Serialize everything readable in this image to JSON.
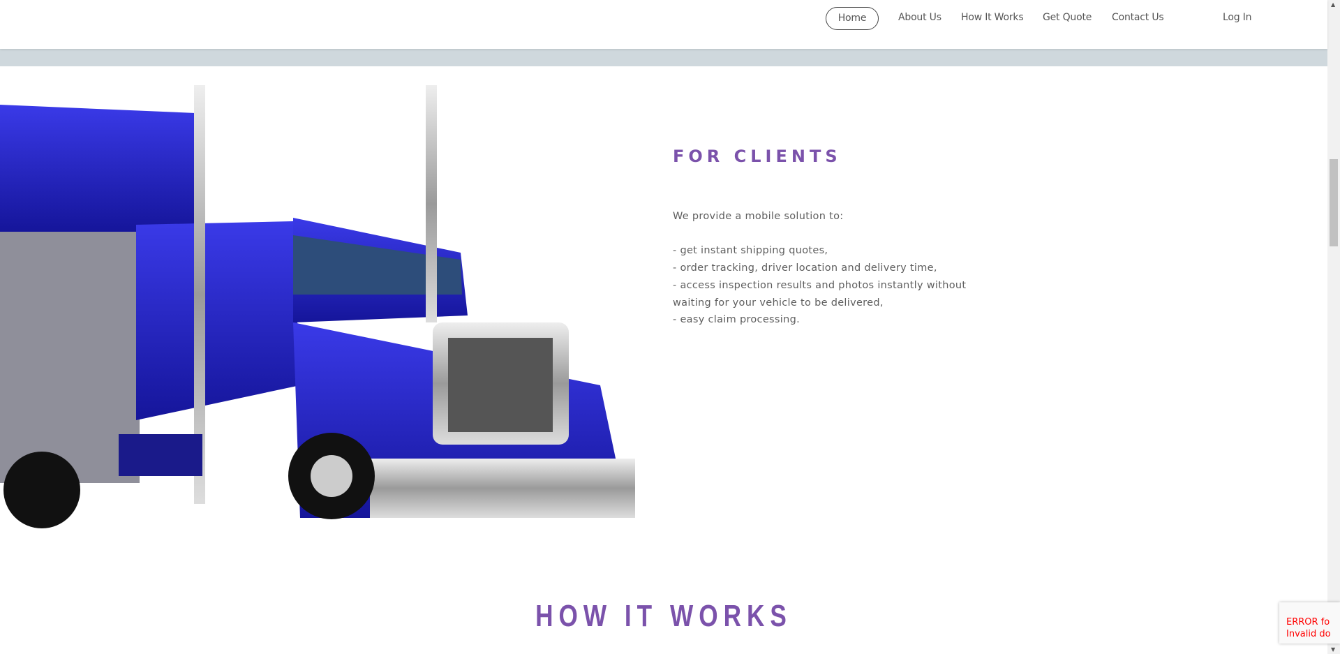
{
  "nav": {
    "items": [
      "Home",
      "About Us",
      "How It Works",
      "Get Quote",
      "Contact Us"
    ],
    "login": "Log In",
    "active": "Home"
  },
  "clients": {
    "title": "FOR CLIENTS",
    "intro": "We provide a mobile solution to:",
    "bullets": [
      "- get instant shipping quotes,",
      "- order tracking, driver location and delivery time,",
      "- access inspection results and photos instantly without waiting for your vehicle to be delivered,",
      "- easy claim processing."
    ]
  },
  "section": {
    "title": "HOW IT WORKS"
  },
  "recaptcha": {
    "line1": "ERROR fo",
    "line2": "Invalid do"
  },
  "colors": {
    "accent": "#7b52ab",
    "band": "#cfd8dd",
    "truck": "#2a2ad0"
  }
}
